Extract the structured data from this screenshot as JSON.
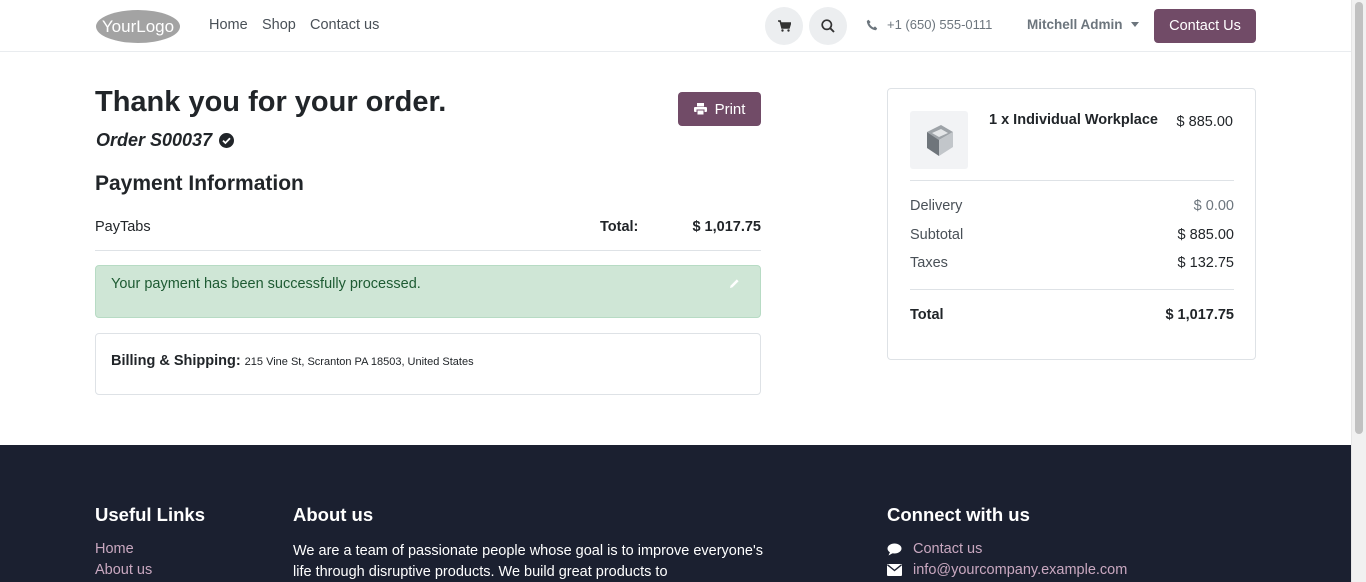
{
  "colors": {
    "brand": "#714b67",
    "success_bg": "#cfe6d6",
    "footer_bg": "#1b2030"
  },
  "header": {
    "logo_text": "YourLogo",
    "nav": [
      "Home",
      "Shop",
      "Contact us"
    ],
    "cart_icon": "cart-icon",
    "search_icon": "search-icon",
    "phone": "+1 (650) 555-0111",
    "user": "Mitchell Admin",
    "contact_button": "Contact Us"
  },
  "order": {
    "title": "Thank you for your order.",
    "reference": "Order S00037",
    "print_label": "Print",
    "payment_heading": "Payment Information",
    "provider": "PayTabs",
    "total_label": "Total:",
    "total_value": "$ 1,017.75",
    "success_message": "Your payment has been successfully processed.",
    "billing_label": "Billing & Shipping:",
    "billing_address": "215 Vine St, Scranton PA 18503, United States"
  },
  "summary": {
    "product_name": "1 x Individual Workplace",
    "product_price": "$ 885.00",
    "rows": [
      {
        "label": "Delivery",
        "value": "$ 0.00"
      },
      {
        "label": "Subtotal",
        "value": "$ 885.00"
      },
      {
        "label": "Taxes",
        "value": "$ 132.75"
      }
    ],
    "total_label": "Total",
    "total_value": "$ 1,017.75"
  },
  "footer": {
    "useful_links_heading": "Useful Links",
    "links": [
      "Home",
      "About us"
    ],
    "about_heading": "About us",
    "about_text": "We are a team of passionate people whose goal is to improve everyone's life through disruptive products. We build great products to",
    "connect_heading": "Connect with us",
    "contact_link": "Contact us",
    "email": "info@yourcompany.example.com"
  }
}
